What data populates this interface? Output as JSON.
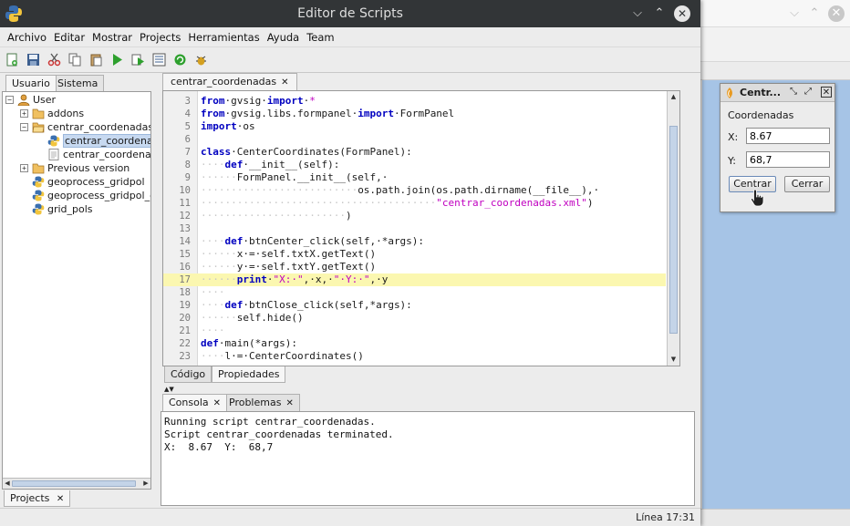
{
  "window": {
    "title": "Editor de Scripts"
  },
  "menu": [
    "Archivo",
    "Editar",
    "Mostrar",
    "Projects",
    "Herramientas",
    "Ayuda",
    "Team"
  ],
  "toolbar": {
    "icons": [
      "new-script-icon",
      "save-icon",
      "cut-icon",
      "copy-icon",
      "paste-icon",
      "run-icon",
      "run-debug-icon",
      "properties-icon",
      "refresh-icon",
      "bug-icon"
    ]
  },
  "left_panel": {
    "tabs": [
      "Usuario",
      "Sistema"
    ],
    "tree": [
      {
        "label": "User",
        "icon": "user-icon",
        "level": 0,
        "expander": "−"
      },
      {
        "label": "addons",
        "icon": "folder-icon",
        "level": 1,
        "expander": "+"
      },
      {
        "label": "centrar_coordenadas",
        "icon": "folder-open-icon",
        "level": 1,
        "expander": "−"
      },
      {
        "label": "centrar_coordenadas",
        "icon": "python-icon",
        "level": 2,
        "expander": "",
        "selected": true
      },
      {
        "label": "centrar_coordenadas",
        "icon": "xml-file-icon",
        "level": 2,
        "expander": ""
      },
      {
        "label": "Previous version",
        "icon": "folder-icon",
        "level": 1,
        "expander": "+"
      },
      {
        "label": "geoprocess_gridpol",
        "icon": "python-icon",
        "level": 1,
        "expander": ""
      },
      {
        "label": "geoprocess_gridpol_g",
        "icon": "python-icon",
        "level": 1,
        "expander": ""
      },
      {
        "label": "grid_pols",
        "icon": "python-icon",
        "level": 1,
        "expander": ""
      }
    ],
    "bottom_tab": "Projects"
  },
  "editor": {
    "tab": "centrar_coordenadas",
    "highlight_line": 17,
    "lines": [
      {
        "n": "3",
        "tokens": [
          [
            "kw",
            "from"
          ],
          [
            "",
            "·gvsig·"
          ],
          [
            "kw",
            "import"
          ],
          [
            "",
            "·"
          ],
          [
            "str",
            "*"
          ]
        ]
      },
      {
        "n": "4",
        "tokens": [
          [
            "kw",
            "from"
          ],
          [
            "",
            "·gvsig.libs.formpanel·"
          ],
          [
            "kw",
            "import"
          ],
          [
            "",
            "·FormPanel"
          ]
        ]
      },
      {
        "n": "5",
        "tokens": [
          [
            "kw",
            "import"
          ],
          [
            "",
            "·os"
          ]
        ]
      },
      {
        "n": "6",
        "tokens": []
      },
      {
        "n": "7",
        "tokens": [
          [
            "kw",
            "class"
          ],
          [
            "",
            "·CenterCoordinates(FormPanel):"
          ]
        ]
      },
      {
        "n": "8",
        "tokens": [
          [
            "dot",
            "····"
          ],
          [
            "kw",
            "def"
          ],
          [
            "",
            "·__init__(self):"
          ]
        ]
      },
      {
        "n": "9",
        "tokens": [
          [
            "dot",
            "······"
          ],
          [
            "",
            "FormPanel.__init__(self,·"
          ]
        ]
      },
      {
        "n": "10",
        "tokens": [
          [
            "dot",
            "··························"
          ],
          [
            "",
            "os.path.join(os.path.dirname(__file__),·"
          ]
        ]
      },
      {
        "n": "11",
        "tokens": [
          [
            "dot",
            "·······································"
          ],
          [
            "str",
            "\"centrar_coordenadas.xml\""
          ],
          [
            "",
            ")"
          ]
        ]
      },
      {
        "n": "12",
        "tokens": [
          [
            "dot",
            "························"
          ],
          [
            "",
            ")"
          ]
        ]
      },
      {
        "n": "13",
        "tokens": []
      },
      {
        "n": "14",
        "tokens": [
          [
            "dot",
            "····"
          ],
          [
            "kw",
            "def"
          ],
          [
            "",
            "·btnCenter_click(self,·*args):"
          ]
        ]
      },
      {
        "n": "15",
        "tokens": [
          [
            "dot",
            "······"
          ],
          [
            "",
            "x·=·self.txtX.getText()"
          ]
        ]
      },
      {
        "n": "16",
        "tokens": [
          [
            "dot",
            "······"
          ],
          [
            "",
            "y·=·self.txtY.getText()"
          ]
        ]
      },
      {
        "n": "17",
        "tokens": [
          [
            "dot",
            "······"
          ],
          [
            "kw",
            "print"
          ],
          [
            "",
            "·"
          ],
          [
            "str",
            "\"X:·\""
          ],
          [
            "",
            ",·x,·"
          ],
          [
            "str",
            "\"·Y:·\""
          ],
          [
            "",
            ",·y"
          ]
        ]
      },
      {
        "n": "18",
        "tokens": [
          [
            "dot",
            "····"
          ]
        ]
      },
      {
        "n": "19",
        "tokens": [
          [
            "dot",
            "····"
          ],
          [
            "kw",
            "def"
          ],
          [
            "",
            "·btnClose_click(self,*args):"
          ]
        ]
      },
      {
        "n": "20",
        "tokens": [
          [
            "dot",
            "······"
          ],
          [
            "",
            "self.hide()"
          ]
        ]
      },
      {
        "n": "21",
        "tokens": [
          [
            "dot",
            "····"
          ]
        ]
      },
      {
        "n": "22",
        "tokens": [
          [
            "kw",
            "def"
          ],
          [
            "",
            "·main(*args):"
          ]
        ]
      },
      {
        "n": "23",
        "tokens": [
          [
            "dot",
            "····"
          ],
          [
            "",
            "l·=·CenterCoordinates()"
          ]
        ]
      }
    ],
    "subtabs": [
      "Código",
      "Propiedades"
    ]
  },
  "bottom": {
    "tabs": [
      "Consola",
      "Problemas"
    ],
    "console_lines": [
      "Running script centrar_coordenadas.",
      "Script centrar_coordenadas terminated.",
      "X:  8.67  Y:  68,7"
    ]
  },
  "status": {
    "position": "Línea 17:31"
  },
  "dialog": {
    "title": "Centr...",
    "heading": "Coordenadas",
    "x_label": "X:",
    "x_value": "8.67",
    "y_label": "Y:",
    "y_value": "68,7",
    "ok_label": "Centrar",
    "cancel_label": "Cerrar"
  },
  "colors": {
    "titlebar": "#323537",
    "keyword": "#0000c0",
    "string": "#c000c0",
    "highlight": "#fbf7b0",
    "selection": "#c7d9f0",
    "desktop_blue": "#a6c4e6"
  }
}
